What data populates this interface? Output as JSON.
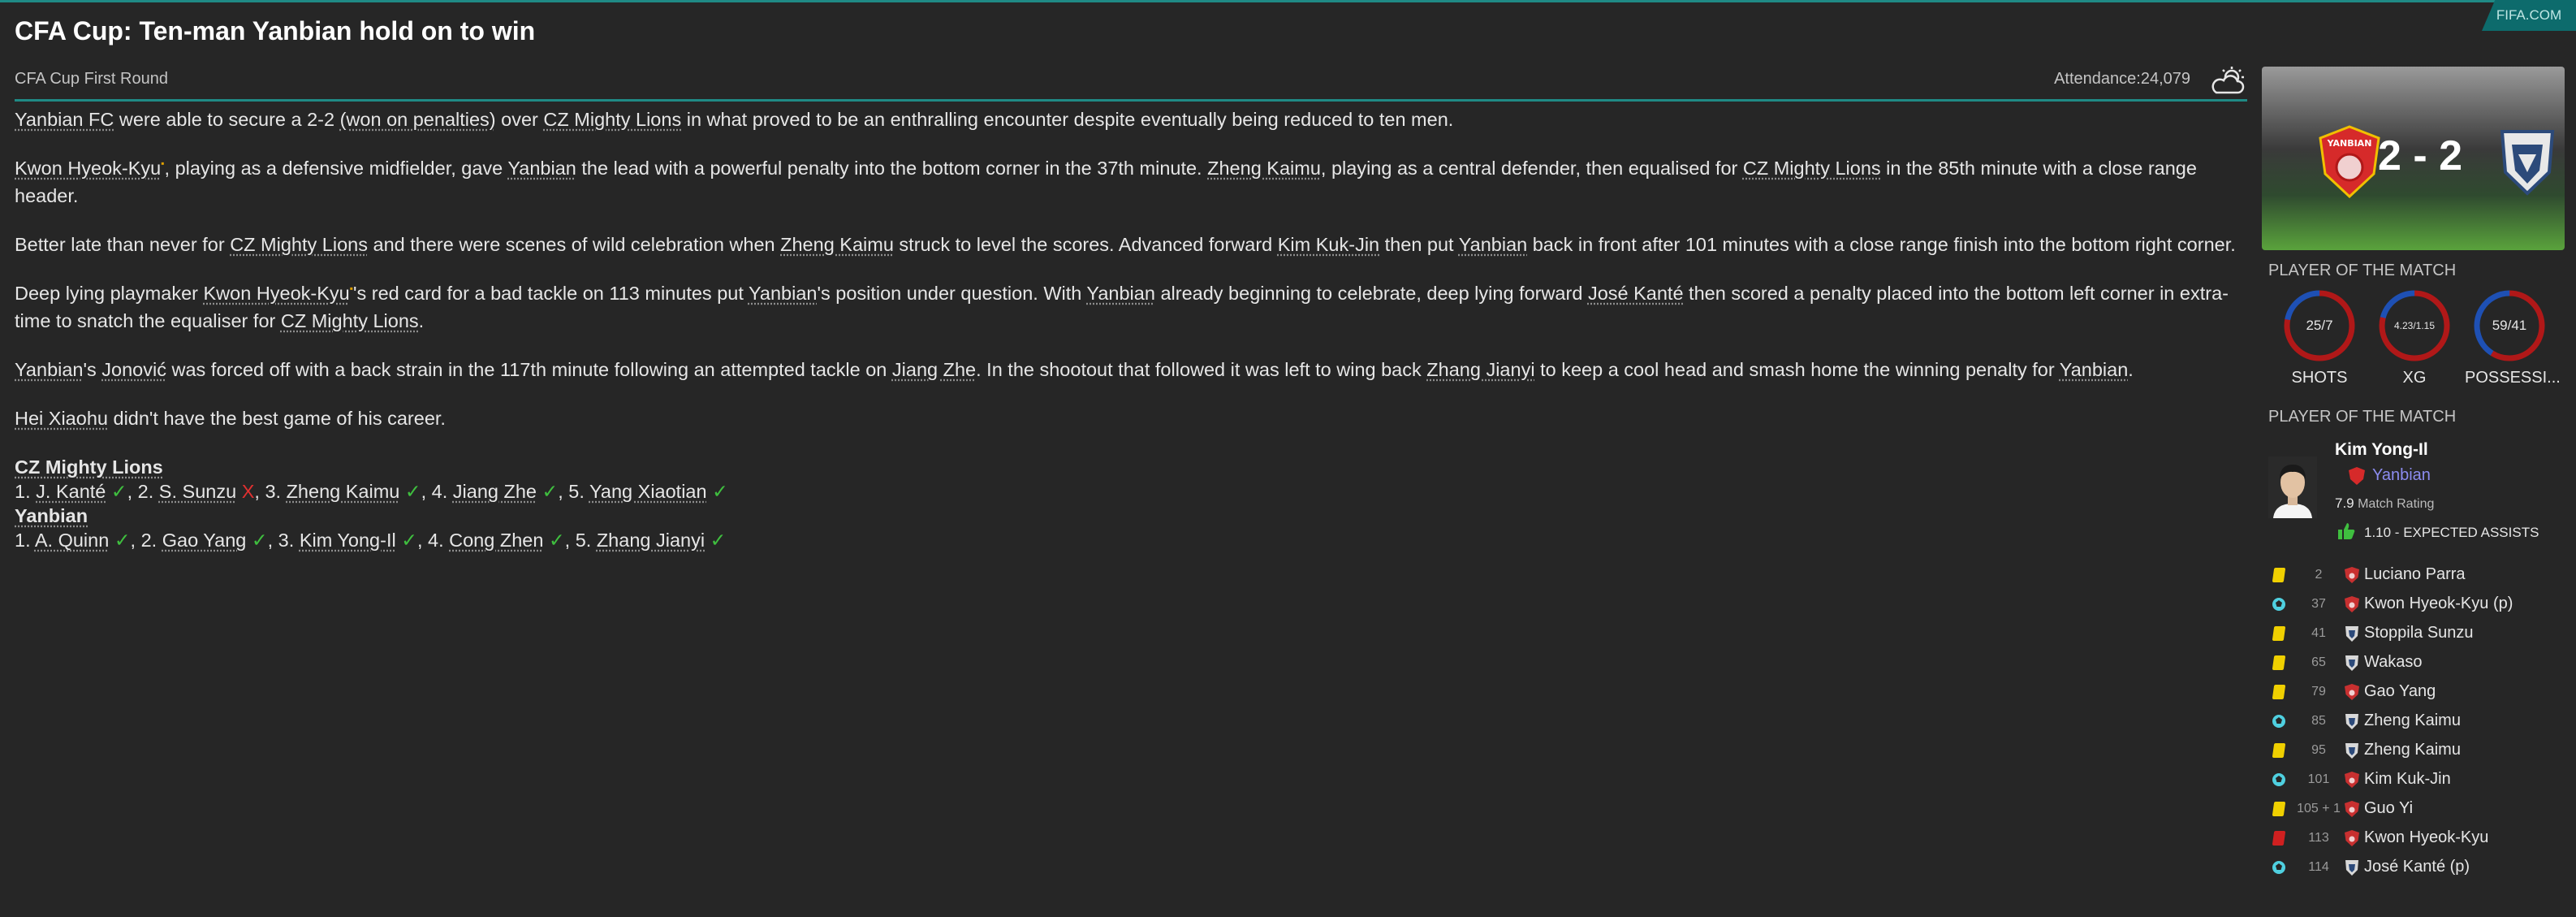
{
  "header": {
    "title": "CFA Cup: Ten-man Yanbian hold on to win",
    "fifa_label": "FIFA.COM",
    "competition": "CFA Cup First Round",
    "attendance_label": "Attendance:",
    "attendance_value": "24,079",
    "weather_icon": "cloudy-sun-icon"
  },
  "report": {
    "p1": {
      "a": "Yanbian FC",
      "b": " were able to secure a 2-2 ",
      "c": "(won on penalties)",
      "d": " over ",
      "e": "CZ Mighty Lions",
      "f": " in what proved to be an enthralling encounter despite eventually being reduced to ten men."
    },
    "p2": {
      "a": "Kwon Hyeok-Kyu",
      "b": ", playing as a defensive midfielder, gave ",
      "c": "Yanbian",
      "d": " the lead with a powerful penalty into the bottom corner in the 37th minute. ",
      "e": "Zheng Kaimu",
      "f": ", playing as a central defender, then equalised for ",
      "g": "CZ Mighty Lions",
      "h": " in the 85th minute with a close range header."
    },
    "p3": {
      "a": "Better late than never for ",
      "b": "CZ Mighty Lions",
      "c": " and there were scenes of wild celebration when ",
      "d": "Zheng Kaimu",
      "e": " struck to level the scores. Advanced forward ",
      "f": "Kim Kuk-Jin",
      "g": " then put ",
      "h": "Yanbian",
      "i": " back in front after 101 minutes with a close range finish into the bottom right corner."
    },
    "p4": {
      "a": "Deep lying playmaker ",
      "b": "Kwon Hyeok-Kyu",
      "c": "'s red card for a bad tackle on 113 minutes put ",
      "d": "Yanbian",
      "e": "'s position under question. With ",
      "f": "Yanbian",
      "g": " already beginning to celebrate, deep lying forward ",
      "h": "José Kanté",
      "i": " then scored a penalty placed into the bottom left corner in extra-time to snatch the equaliser for ",
      "j": "CZ Mighty Lions",
      "k": "."
    },
    "p5": {
      "a": "Yanbian",
      "b": "'s ",
      "c": "Jonović",
      "d": " was forced off with a back strain in the 117th minute following an attempted tackle on ",
      "e": "Jiang Zhe",
      "f": ". In the shootout that followed it was left to wing back ",
      "g": "Zhang Jianyi",
      "h": " to keep a cool head and smash home the winning penalty for ",
      "i": "Yanbian",
      "j": "."
    },
    "p6": {
      "a": "Hei Xiaohu",
      "b": " didn't have the best game of his career."
    }
  },
  "shootout": {
    "team1": "CZ Mighty Lions",
    "team1_line": [
      {
        "n": "1. ",
        "name": "J. Kanté",
        "mark": "✓",
        "ok": true
      },
      {
        "n": ", 2. ",
        "name": "S. Sunzu",
        "mark": "X",
        "ok": false
      },
      {
        "n": ", 3. ",
        "name": "Zheng Kaimu",
        "mark": "✓",
        "ok": true
      },
      {
        "n": ", 4. ",
        "name": "Jiang Zhe",
        "mark": "✓",
        "ok": true
      },
      {
        "n": ", 5. ",
        "name": "Yang Xiaotian",
        "mark": "✓",
        "ok": true
      }
    ],
    "team2": "Yanbian",
    "team2_line": [
      {
        "n": "1. ",
        "name": "A. Quinn",
        "mark": "✓",
        "ok": true
      },
      {
        "n": ", 2. ",
        "name": "Gao Yang",
        "mark": "✓",
        "ok": true
      },
      {
        "n": ", 3. ",
        "name": "Kim Yong-Il",
        "mark": "✓",
        "ok": true
      },
      {
        "n": ", 4. ",
        "name": "Cong Zhen",
        "mark": "✓",
        "ok": true
      },
      {
        "n": ", 5. ",
        "name": "Zhang Jianyi",
        "mark": "✓",
        "ok": true
      }
    ]
  },
  "scoreboard": {
    "score": "2 - 2",
    "home_crest_text": "YANBIAN",
    "colors": {
      "home": "#d62a2a",
      "away": "#2c4a7a",
      "accent": "#1f8a85"
    }
  },
  "stats": {
    "heading": "PLAYER OF THE MATCH",
    "items": [
      {
        "value": "25/7",
        "label": "SHOTS",
        "home_share": 0.78
      },
      {
        "value": "4.23/1.15",
        "label": "XG",
        "home_share": 0.79
      },
      {
        "value": "59/41",
        "label": "POSSESSI...",
        "home_share": 0.59
      }
    ]
  },
  "potm": {
    "heading": "PLAYER OF THE MATCH",
    "name": "Kim Yong-Il",
    "team": "Yanbian",
    "rating_value": "7.9",
    "rating_label": "Match Rating",
    "xa_label": "1.10 - EXPECTED ASSISTS"
  },
  "events": [
    {
      "type": "yellow-card-icon",
      "minute": "2",
      "team": "home",
      "player": "Luciano Parra"
    },
    {
      "type": "goal-icon",
      "minute": "37",
      "team": "home",
      "player": "Kwon Hyeok-Kyu (p)"
    },
    {
      "type": "yellow-card-icon",
      "minute": "41",
      "team": "away",
      "player": "Stoppila Sunzu"
    },
    {
      "type": "yellow-card-icon",
      "minute": "65",
      "team": "away",
      "player": "Wakaso"
    },
    {
      "type": "yellow-card-icon",
      "minute": "79",
      "team": "home",
      "player": "Gao Yang"
    },
    {
      "type": "goal-icon",
      "minute": "85",
      "team": "away",
      "player": "Zheng Kaimu"
    },
    {
      "type": "yellow-card-icon",
      "minute": "95",
      "team": "away",
      "player": "Zheng Kaimu"
    },
    {
      "type": "goal-icon",
      "minute": "101",
      "team": "home",
      "player": "Kim Kuk-Jin"
    },
    {
      "type": "yellow-card-icon",
      "minute": "105 + 1",
      "team": "home",
      "player": "Guo Yi"
    },
    {
      "type": "red-card-icon",
      "minute": "113",
      "team": "home",
      "player": "Kwon Hyeok-Kyu"
    },
    {
      "type": "goal-icon",
      "minute": "114",
      "team": "away",
      "player": "José Kanté (p)"
    }
  ]
}
